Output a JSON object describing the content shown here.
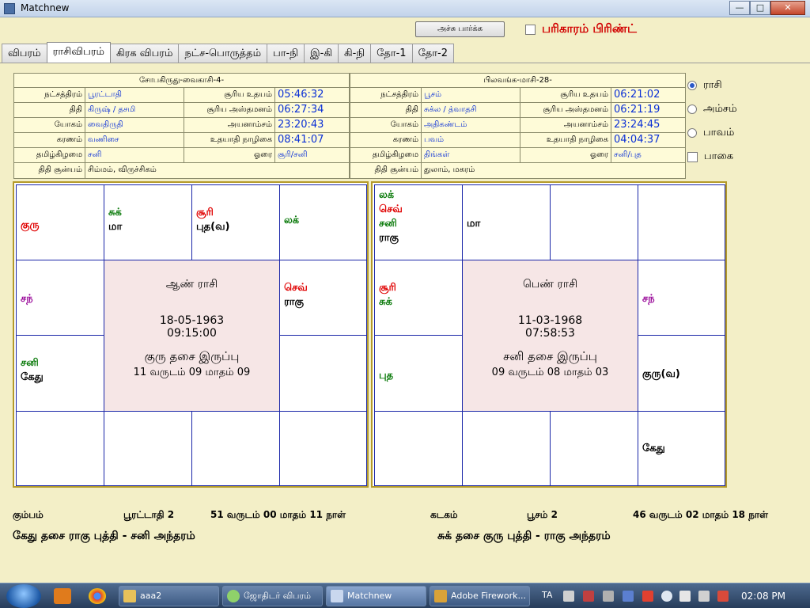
{
  "window": {
    "title": "Matchnew"
  },
  "toolbar": {
    "print_label": "அச்சு பார்க்க",
    "remedy_label": "பரிகாரம் பிரிண்ட்"
  },
  "tabs": [
    "விபரம்",
    "ராசிவிபரம்",
    "கிரக விபரம்",
    "நட்ச-பொருத்தம்",
    "பா-நி",
    "இ-கி",
    "கி-நி",
    "தோ-1",
    "தோ-2"
  ],
  "left_info": {
    "heading": "சோபகிருது-வைகாசி-4-",
    "nakshatra_label": "நட்சத்திரம்",
    "nakshatra": "பூரட்டாதி",
    "sunrise_label": "சூரிய உதயம்",
    "sunrise": "05:46:32",
    "thithi_label": "திதி",
    "thithi": "கிருஷ் / தசமி",
    "sunset_label": "சூரிய அஸ்தமனம்",
    "sunset": "06:27:34",
    "yogam_label": "யோகம்",
    "yogam": "வைதிருதி",
    "ayanamsam_label": "அயனாம்சம்",
    "ayanamsam": "23:20:43",
    "karanam_label": "கரணம்",
    "karanam": "வணிசை",
    "udayathi_label": "உதயாதி நாழிகை",
    "udayathi": "08:41:07",
    "tamilday_label": "தமிழ்கிழமை",
    "tamilday": "சனி",
    "horai_label": "ஓரை",
    "horai": "சூரி/சனி",
    "soonyam_label": "திதி சூன்யம்",
    "soonyam": "சிம்மம், விருச்சிகம்"
  },
  "right_info": {
    "heading": "பிலவங்க-மாசி-28-",
    "nakshatra_label": "நட்சத்திரம்",
    "nakshatra": "பூசம்",
    "sunrise_label": "சூரிய உதயம்",
    "sunrise": "06:21:02",
    "thithi_label": "திதி",
    "thithi": "சுக்ல / த்வாதசி",
    "sunset_label": "சூரிய அஸ்தமனம்",
    "sunset": "06:21:19",
    "yogam_label": "யோகம்",
    "yogam": "அதிகண்டம்",
    "ayanamsam_label": "அயனாம்சம்",
    "ayanamsam": "23:24:45",
    "karanam_label": "கரணம்",
    "karanam": "பவம்",
    "udayathi_label": "உதயாதி நாழிகை",
    "udayathi": "04:04:37",
    "tamilday_label": "தமிழ்கிழமை",
    "tamilday": "திங்கள்",
    "horai_label": "ஓரை",
    "horai": "சனி/புத",
    "soonyam_label": "திதி சூன்யம்",
    "soonyam": "துலாம், மகரம்"
  },
  "options": {
    "rasi": "ராசி",
    "amsam": "அம்சம்",
    "bhavam": "பாவம்",
    "bagai": "பாகை"
  },
  "male_chart": {
    "title": "ஆண் ராசி",
    "date": "18-05-1963",
    "time": "09:15:00",
    "dasa": "குரு தசை இருப்பு",
    "period": "11 வருடம் 09 மாதம் 09",
    "c1": "குரு",
    "c2a": "சுக்",
    "c2b": "மா",
    "c3a": "சூரி",
    "c3b": "புத(வ)",
    "c4": "லக்",
    "c5": "சந்",
    "c6a": "செவ்",
    "c6b": "ராகு",
    "c7a": "சனி",
    "c7b": "கேது"
  },
  "female_chart": {
    "title": "பெண் ராசி",
    "date": "11-03-1968",
    "time": "07:58:53",
    "dasa": "சனி தசை இருப்பு",
    "period": "09 வருடம் 08 மாதம் 03",
    "c1a": "லக்",
    "c1b": "செவ்",
    "c1c": "சனி",
    "c1d": "ராகு",
    "c2": "மா",
    "c5a": "சூரி",
    "c5b": "சுக்",
    "c6": "சந்",
    "c7": "புத",
    "c8": "குரு(வ)",
    "c12": "கேது"
  },
  "bottom": {
    "male_rasi": "கும்பம்",
    "male_star": "பூரட்டாதி 2",
    "male_age": "51 வருடம் 00 மாதம் 11 நாள்",
    "female_rasi": "கடகம்",
    "female_star": "பூசம் 2",
    "female_age": "46 வருடம் 02 மாதம் 18 நாள்",
    "male_dasa": "கேது தசை ராகு புத்தி - சனி அந்தரம்",
    "female_dasa": "சுக் தசை குரு புத்தி - ராகு அந்தரம்"
  },
  "taskbar": {
    "tasks": [
      "aaa2",
      "ஜோதிடர் விபரம்",
      "Matchnew",
      "Adobe Firework..."
    ],
    "lang": "TA",
    "clock": "02:08 PM"
  }
}
